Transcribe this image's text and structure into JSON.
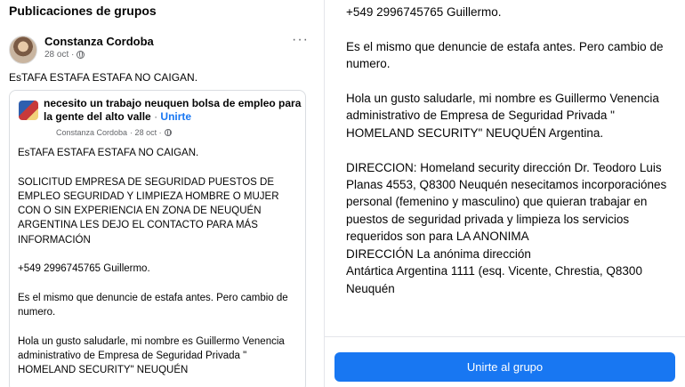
{
  "section": {
    "title": "Publicaciones de grupos"
  },
  "post": {
    "author": "Constanza Cordoba",
    "date": "28 oct ·",
    "privacy_icon": "globe-icon",
    "more_icon": "more-options-icon",
    "text": "EsTAFA ESTAFA ESTAFA NO CAIGAN."
  },
  "shared_post": {
    "group_name": "necesito un trabajo neuquen bolsa de empleo para la gente del alto valle",
    "separator": "·",
    "join_link": "Unirte",
    "author": "Constanza Cordoba",
    "date": "· 28 oct ·",
    "body": "EsTAFA ESTAFA ESTAFA NO CAIGAN.\n\nSOLICITUD EMPRESA DE SEGURIDAD PUESTOS DE EMPLEO SEGURIDAD Y LIMPIEZA HOMBRE O MUJER CON O SIN EXPERIENCIA EN ZONA DE NEUQUÉN ARGENTINA LES DEJO EL CONTACTO PARA MÁS INFORMACIÓN\n\n+549 2996745765 Guillermo.\n\nEs el mismo que denuncie de estafa antes. Pero cambio de numero.\n\nHola un gusto saludarle, mi nombre es Guillermo Venencia   administrativo de Empresa de Seguridad Privada  \" HOMELAND SECURITY\" NEUQUÉN"
  },
  "detail": {
    "body": "+549 2996745765 Guillermo.\n\nEs el mismo que denuncie de estafa antes. Pero cambio de numero.\n\nHola un gusto saludarle, mi nombre es Guillermo Venencia   administrativo de Empresa de Seguridad Privada  \" HOMELAND SECURITY\" NEUQUÉN Argentina.\n\n DIRECCION: Homeland security dirección Dr. Teodoro Luis Planas 4553, Q8300 Neuquén nesecitamos incorporaciónes personal (femenino y masculino) que quieran trabajar en puestos de seguridad privada y limpieza los servicios requeridos son para LA ANONIMA\nDIRECCIÓN La anónima dirección\nAntártica Argentina 1111 (esq. Vicente, Chrestia, Q8300 Neuquén",
    "join_button": "Unirte al grupo"
  },
  "colors": {
    "accent": "#1877f2",
    "meta": "#65676b",
    "text": "#050505"
  }
}
